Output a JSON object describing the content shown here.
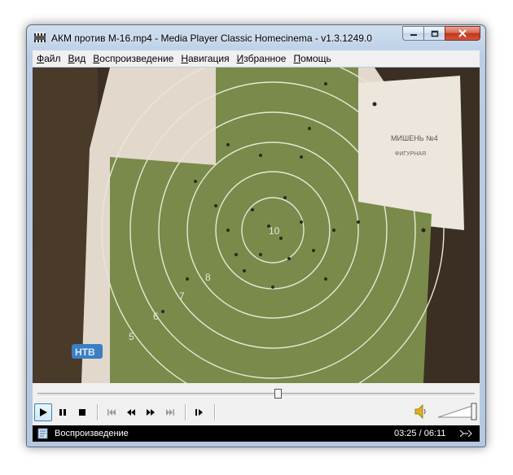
{
  "window": {
    "title": "АКМ против М-16.mp4 - Media Player Classic Homecinema - v1.3.1249.0"
  },
  "menu": {
    "items": [
      "Файл",
      "Вид",
      "Воспроизведение",
      "Навигация",
      "Избранное",
      "Помощь"
    ]
  },
  "video": {
    "target_label": "МИШЕНЬ №4",
    "target_sub": "ФИГУРНАЯ",
    "ring_numbers": [
      "10",
      "8",
      "7",
      "6",
      "5"
    ],
    "channel_logo": "НТВ"
  },
  "seek": {
    "position_fraction": 0.55
  },
  "playback": {
    "buttons": [
      "play-icon",
      "pause-icon",
      "stop-icon",
      "skip-back-icon",
      "rewind-icon",
      "fast-forward-icon",
      "skip-forward-icon",
      "frame-step-icon"
    ]
  },
  "volume": {
    "level_fraction": 1.0
  },
  "status": {
    "state": "Воспроизведение",
    "time": "03:25 / 06:11"
  },
  "colors": {
    "titlebar": "#b9cde4",
    "close_button": "#c0361c",
    "status_bar": "#000000",
    "target_green": "#7a8a4a",
    "paper": "#e6ddd0"
  }
}
